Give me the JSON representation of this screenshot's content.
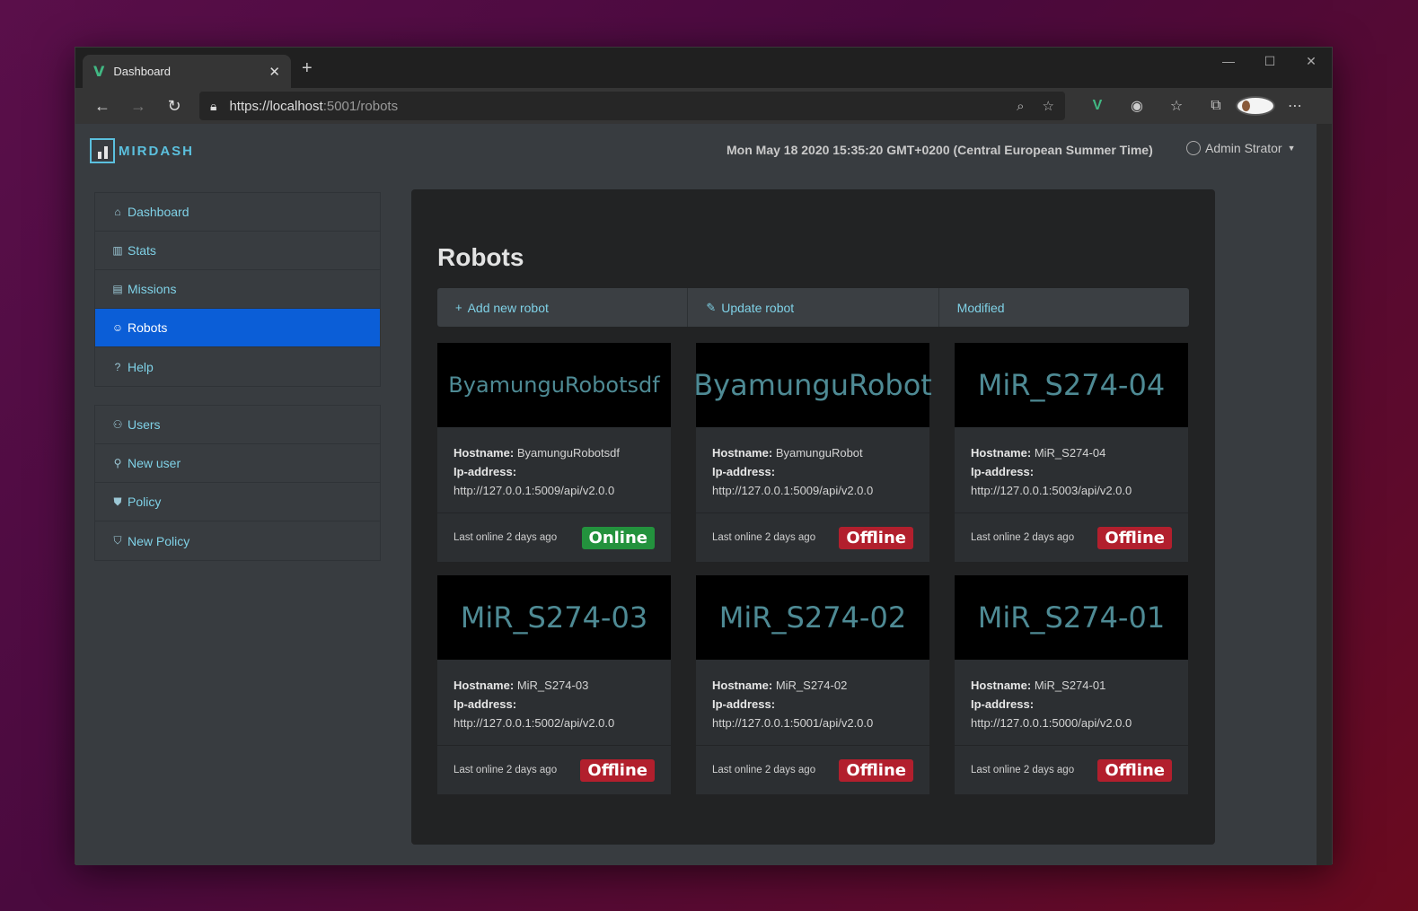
{
  "browser": {
    "tab_title": "Dashboard",
    "tab_close": "✕",
    "new_tab": "+",
    "url_scheme_host": "https://localhost",
    "url_rest": ":5001/robots",
    "win_minimize": "—",
    "win_maximize": "☐",
    "win_close": "✕",
    "more": "⋯"
  },
  "app": {
    "brand": "MIRDASH",
    "datetime": "Mon May 18 2020 15:35:20 GMT+0200 (Central European Summer Time)",
    "user_name": "Admin Strator"
  },
  "sidebar": {
    "group1": [
      {
        "label": "Dashboard",
        "icon": "home-icon",
        "glyph": "⌂"
      },
      {
        "label": "Stats",
        "icon": "bar-chart-icon",
        "glyph": "▥"
      },
      {
        "label": "Missions",
        "icon": "clipboard-icon",
        "glyph": "▤"
      },
      {
        "label": "Robots",
        "icon": "robot-icon",
        "glyph": "☺",
        "active": true
      },
      {
        "label": "Help",
        "icon": "question-icon",
        "glyph": "?"
      }
    ],
    "group2": [
      {
        "label": "Users",
        "icon": "users-icon",
        "glyph": "⚇"
      },
      {
        "label": "New user",
        "icon": "user-plus-icon",
        "glyph": "⚲"
      },
      {
        "label": "Policy",
        "icon": "shield-filled-icon",
        "glyph": "⛊"
      },
      {
        "label": "New Policy",
        "icon": "shield-icon",
        "glyph": "⛉"
      }
    ]
  },
  "main": {
    "title": "Robots",
    "actions": [
      {
        "label": "Add new robot",
        "glyph": "+"
      },
      {
        "label": "Update robot",
        "glyph": "✎"
      },
      {
        "label": "Modified",
        "glyph": ""
      }
    ],
    "labels": {
      "hostname": "Hostname:",
      "ip": "Ip-address:"
    },
    "robots": [
      {
        "name": "ByamunguRobotsdf",
        "hostname": "ByamunguRobotsdf",
        "ip": "http://127.0.0.1:5009/api/v2.0.0",
        "last_online": "Last online 2 days ago",
        "status": "Online"
      },
      {
        "name": "ByamunguRobot",
        "hostname": "ByamunguRobot",
        "ip": "http://127.0.0.1:5009/api/v2.0.0",
        "last_online": "Last online 2 days ago",
        "status": "Offline"
      },
      {
        "name": "MiR_S274-04",
        "hostname": "MiR_S274-04",
        "ip": "http://127.0.0.1:5003/api/v2.0.0",
        "last_online": "Last online 2 days ago",
        "status": "Offline"
      },
      {
        "name": "MiR_S274-03",
        "hostname": "MiR_S274-03",
        "ip": "http://127.0.0.1:5002/api/v2.0.0",
        "last_online": "Last online 2 days ago",
        "status": "Offline"
      },
      {
        "name": "MiR_S274-02",
        "hostname": "MiR_S274-02",
        "ip": "http://127.0.0.1:5001/api/v2.0.0",
        "last_online": "Last online 2 days ago",
        "status": "Offline"
      },
      {
        "name": "MiR_S274-01",
        "hostname": "MiR_S274-01",
        "ip": "http://127.0.0.1:5000/api/v2.0.0",
        "last_online": "Last online 2 days ago",
        "status": "Offline"
      }
    ]
  },
  "colors": {
    "accent": "#0b5ed7",
    "link": "#7fd1e6",
    "online": "#23923d",
    "offline": "#b21f2d",
    "brand": "#5bc0de"
  }
}
